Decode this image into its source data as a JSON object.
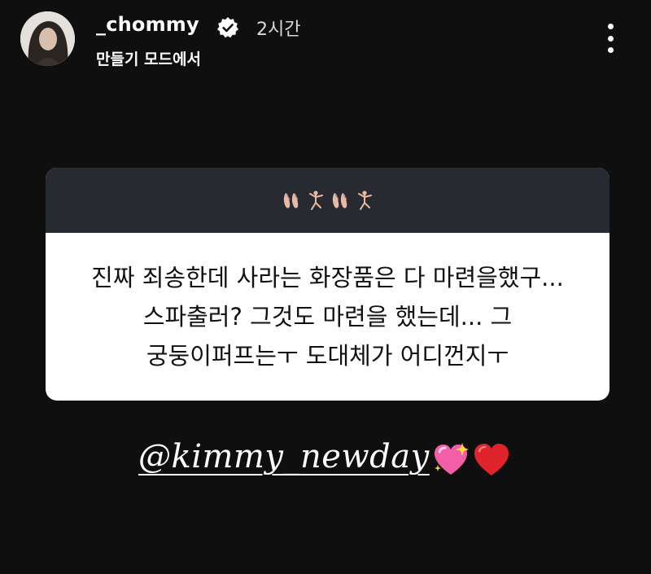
{
  "header": {
    "username": "_chommy",
    "time": "2시간",
    "subtitle": "만들기 모드에서",
    "verified_icon": "verified-badge-icon",
    "menu_icon": "more-vertical-icon"
  },
  "question_card": {
    "header_icons": [
      "ballet-shoes-icon",
      "dancer-icon",
      "ballet-shoes-icon",
      "dancer-icon"
    ],
    "text_lines": [
      "진짜 죄송한데 사라는 화장품은 다 마련을했구...",
      "스파출러? 그것도 마련을 했는데... 그",
      "궁둥이퍼프는ㅜ 도대체가 어디껀지ㅜ"
    ]
  },
  "mention": {
    "text": "@kimmy_newday",
    "emoji": [
      "sparkling-heart-icon",
      "red-heart-icon"
    ]
  },
  "colors": {
    "background": "#0f0f0f",
    "card_header": "#272b31",
    "card_body": "#ffffff",
    "heart_red": "#e0242c",
    "heart_pink": "#f25fa8"
  }
}
